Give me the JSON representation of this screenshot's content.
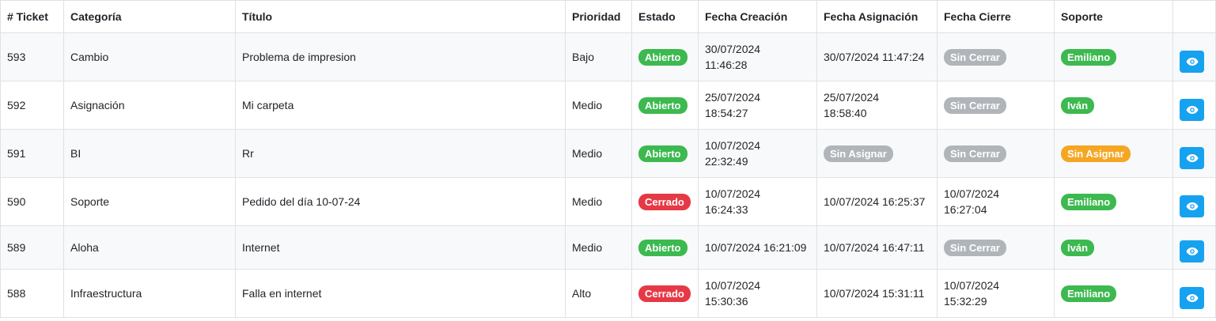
{
  "table": {
    "headers": [
      "# Ticket",
      "Categoría",
      "Título",
      "Prioridad",
      "Estado",
      "Fecha Creación",
      "Fecha Asignación",
      "Fecha Cierre",
      "Soporte",
      ""
    ],
    "rows": [
      {
        "ticket": "593",
        "categoria": "Cambio",
        "titulo": "Problema de impresion",
        "prioridad": "Bajo",
        "estado": "Abierto",
        "estado_color": "#3cb94f",
        "creacion_1": "30/07/2024",
        "creacion_2": "11:46:28",
        "asignacion_1": "30/07/2024 11:47:24",
        "asignacion_2": "",
        "asignacion_badge": "",
        "cierre_1": "",
        "cierre_2": "",
        "cierre_badge": "Sin Cerrar",
        "soporte": "Emiliano",
        "soporte_color": "#3cb94f"
      },
      {
        "ticket": "592",
        "categoria": "Asignación",
        "titulo": "Mi carpeta",
        "prioridad": "Medio",
        "estado": "Abierto",
        "estado_color": "#3cb94f",
        "creacion_1": "25/07/2024",
        "creacion_2": "18:54:27",
        "asignacion_1": "25/07/2024",
        "asignacion_2": "18:58:40",
        "asignacion_badge": "",
        "cierre_1": "",
        "cierre_2": "",
        "cierre_badge": "Sin Cerrar",
        "soporte": "Iván",
        "soporte_color": "#3cb94f"
      },
      {
        "ticket": "591",
        "categoria": "BI",
        "titulo": "Rr",
        "prioridad": "Medio",
        "estado": "Abierto",
        "estado_color": "#3cb94f",
        "creacion_1": "10/07/2024",
        "creacion_2": "22:32:49",
        "asignacion_1": "",
        "asignacion_2": "",
        "asignacion_badge": "Sin Asignar",
        "cierre_1": "",
        "cierre_2": "",
        "cierre_badge": "Sin Cerrar",
        "soporte": "Sin Asignar",
        "soporte_color": "#f5a623"
      },
      {
        "ticket": "590",
        "categoria": "Soporte",
        "titulo": "Pedido del día 10-07-24",
        "prioridad": "Medio",
        "estado": "Cerrado",
        "estado_color": "#e63946",
        "creacion_1": "10/07/2024",
        "creacion_2": "16:24:33",
        "asignacion_1": "10/07/2024 16:25:37",
        "asignacion_2": "",
        "asignacion_badge": "",
        "cierre_1": "10/07/2024",
        "cierre_2": "16:27:04",
        "cierre_badge": "",
        "soporte": "Emiliano",
        "soporte_color": "#3cb94f"
      },
      {
        "ticket": "589",
        "categoria": "Aloha",
        "titulo": "Internet",
        "prioridad": "Medio",
        "estado": "Abierto",
        "estado_color": "#3cb94f",
        "creacion_1": "10/07/2024 16:21:09",
        "creacion_2": "",
        "asignacion_1": "10/07/2024 16:47:11",
        "asignacion_2": "",
        "asignacion_badge": "",
        "cierre_1": "",
        "cierre_2": "",
        "cierre_badge": "Sin Cerrar",
        "soporte": "Iván",
        "soporte_color": "#3cb94f"
      },
      {
        "ticket": "588",
        "categoria": "Infraestructura",
        "titulo": "Falla en internet",
        "prioridad": "Alto",
        "estado": "Cerrado",
        "estado_color": "#e63946",
        "creacion_1": "10/07/2024",
        "creacion_2": "15:30:36",
        "asignacion_1": "10/07/2024 15:31:11",
        "asignacion_2": "",
        "asignacion_badge": "",
        "cierre_1": "10/07/2024",
        "cierre_2": "15:32:29",
        "cierre_badge": "",
        "soporte": "Emiliano",
        "soporte_color": "#3cb94f"
      }
    ]
  },
  "view_button": {
    "icon": "eye-icon",
    "color": "#17a2f0"
  }
}
